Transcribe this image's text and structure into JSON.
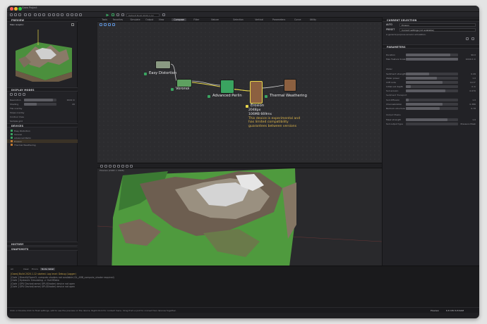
{
  "window": {
    "title": "Gaea Project"
  },
  "toolbar": {
    "seed_placeholder": "Default Build 2020.1.12"
  },
  "left": {
    "preview_title": "PREVIEW",
    "preview_mode": "Main Graphic",
    "display_title": "DISPLAY MODES",
    "display_rows": [
      {
        "label": "Resolution",
        "value": "1024 m"
      },
      {
        "label": "Shading",
        "value": "20"
      },
      {
        "label": "Tile overlay",
        "value": ""
      },
      {
        "label": "Slope overlay",
        "value": ""
      },
      {
        "label": "Contour lines",
        "value": ""
      },
      {
        "label": "Sample grid",
        "value": ""
      }
    ],
    "devices_title": "DEVICES",
    "devices": [
      "Easy Distortion",
      "Voronoi",
      "Advanced Perlin",
      "Erosion",
      "Thermal Weathering"
    ],
    "history_title": "HISTORY",
    "snapshots_title": "SNAPSHOTS"
  },
  "tabs": [
    "Tools",
    "Favorites",
    "Simulate",
    "Output",
    "View",
    "Compose",
    "Filter",
    "Nature",
    "Selection",
    "Vertical",
    "Parameters",
    "Curve",
    "Utility"
  ],
  "nodes": {
    "easy_distortion": "Easy Distortion",
    "voronoi": "Voronoi",
    "advanced_perlin": "Advanced Perlin",
    "erosion": "Erosion",
    "thermal": "Thermal Weathering",
    "erosion_info": [
      "2048px",
      "106MB  669ms",
      "This device is experimental and",
      "has limited compatibility",
      "guarantees between versions"
    ]
  },
  "viewport": {
    "label": "Preview (2048 × 2048)"
  },
  "right": {
    "title": "CURRENT SELECTION",
    "tab_a": "AUTO",
    "tab_b": "Erosion",
    "preset_label": "PRESET",
    "preset_value": "Current settings (12 available)",
    "description": "A general purpose erosion simulation.",
    "params_title": "PARAMETERS",
    "duration_label": "Duration",
    "rows1": [
      {
        "label": "Duration",
        "value": "90.0"
      },
      {
        "label": "Max Feature Scale",
        "value": "1024.0 m"
      }
    ],
    "group2": "Water",
    "rows2": [
      {
        "label": "Sediment strength",
        "value": "0.49"
      },
      {
        "label": "Water power",
        "value": "1.0"
      },
      {
        "label": "Cliff code",
        "value": "10.3°"
      },
      {
        "label": "Initial soil depth",
        "value": "0 m"
      },
      {
        "label": "Soil erosion",
        "value": "0.070"
      }
    ],
    "group3": "Sediment Transport",
    "rows3": [
      {
        "label": "Soil diffusion",
        "value": "1.0"
      },
      {
        "label": "Channelization",
        "value": "0.386"
      },
      {
        "label": "Bedrock structure",
        "value": "0.78"
      }
    ],
    "group4": "Output Masks",
    "rows4": [
      {
        "label": "Mask strength",
        "value": "1.0"
      },
      {
        "label": "Soil output type",
        "value": "Pressure Mask"
      }
    ]
  },
  "console": {
    "tabs": [
      "All",
      "Clear",
      "Errors",
      "Node detail"
    ],
    "lines": [
      "[Gaea] Build 2020.1.12 started. Log level: Debug (Logger)",
      "[Clofe  ] DirectX/OpenCL compute shaders not available (GL_ARB_compute_shader required)",
      "[Clofe  ] Hydraulic Simulating -> OutOfData",
      "[Clofe  ] GPU Device(name) GPU(Shader) device not open",
      "[Clofe  ] GPU Device(name) GPU(Shader) device not open"
    ]
  },
  "status": {
    "hint": "Click or Double-Click to float settings, edit to see the preview on the device. Right-Click for context menu. Drag from a port to connect two devices together.",
    "right": "Preview",
    "cpu": "6.8  CPU  6.8  RAM"
  },
  "colors": {
    "node_green": "#3aa460",
    "erosion_orange": "#c07a33",
    "wire_yellow": "#e8d74a",
    "warning": "#e2b94a"
  }
}
